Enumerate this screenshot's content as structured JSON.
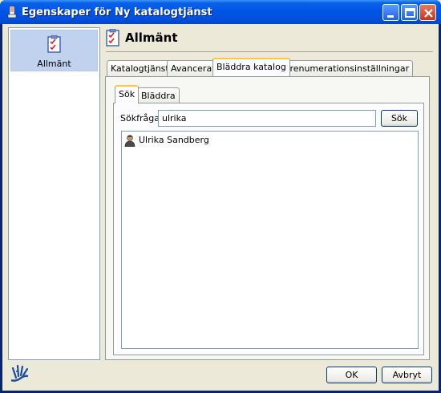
{
  "window": {
    "title": "Egenskaper för Ny katalogtjänst",
    "controls": [
      "minimize",
      "maximize",
      "close"
    ]
  },
  "sidebar": {
    "items": [
      {
        "label": "Allmänt",
        "icon": "checklist-icon",
        "selected": true
      }
    ]
  },
  "section": {
    "title": "Allmänt",
    "icon": "checklist-icon"
  },
  "tabs": [
    {
      "label": "Katalogtjänst"
    },
    {
      "label": "Avancerat"
    },
    {
      "label": "Bläddra katalog",
      "active": true
    },
    {
      "label": "Prenumerationsinställningar"
    }
  ],
  "subtabs": [
    {
      "label": "Sök",
      "active": true
    },
    {
      "label": "Bläddra"
    }
  ],
  "search": {
    "label": "Sökfråga",
    "value": "ulrika",
    "button": "Sök"
  },
  "results": [
    {
      "name": "Ulrika Sandberg",
      "icon": "user-icon"
    }
  ],
  "footer": {
    "ok": "OK",
    "cancel": "Avbryt"
  },
  "colors": {
    "titlebar": "#0055E5",
    "active_tab_accent": "#FFC83C",
    "selection": "#C1D2EE"
  }
}
